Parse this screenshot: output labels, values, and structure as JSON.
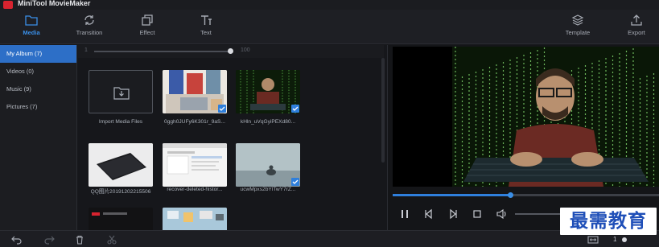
{
  "app": {
    "title": "MiniTool MovieMaker"
  },
  "toolbar": {
    "tabs": [
      {
        "label": "Media",
        "icon": "folder-icon",
        "active": true
      },
      {
        "label": "Transition",
        "icon": "transition-icon",
        "active": false
      },
      {
        "label": "Effect",
        "icon": "effect-icon",
        "active": false
      },
      {
        "label": "Text",
        "icon": "text-icon",
        "active": false
      }
    ],
    "template": {
      "label": "Template",
      "icon": "template-layers-icon"
    },
    "export": {
      "label": "Export",
      "icon": "export-icon"
    }
  },
  "sidebar": {
    "items": [
      {
        "label": "My Album  (7)",
        "active": true
      },
      {
        "label": "Videos  (0)",
        "active": false
      },
      {
        "label": "Music  (9)",
        "active": false
      },
      {
        "label": "Pictures  (7)",
        "active": false
      }
    ]
  },
  "media": {
    "slider": {
      "min_label": "1",
      "max_label": "100",
      "value": 100
    },
    "import_label": "Import Media Files",
    "items": [
      {
        "label": "0ggh0JUFy6K301r_9aS...",
        "selected": true
      },
      {
        "label": "kHln_uVqGyiPEXd80...",
        "selected": true
      },
      {
        "label": "QQ图片20191202215506",
        "selected": false
      },
      {
        "label": "recover-deleted-histor...",
        "selected": false
      },
      {
        "label": "ucwMpxs2bYlTwY7rZ...",
        "selected": true
      }
    ]
  },
  "player": {
    "progress": 0.44,
    "colors": {
      "accent": "#2f7fdc",
      "matrix": "#7ed36a"
    }
  },
  "bottom": {
    "zoom_value": "1"
  },
  "watermark": {
    "text": "最需教育"
  }
}
